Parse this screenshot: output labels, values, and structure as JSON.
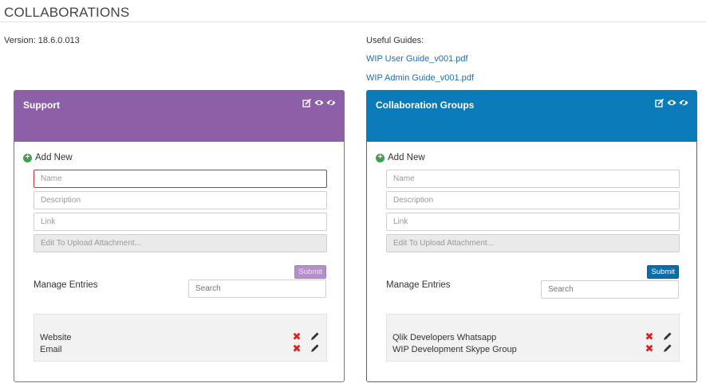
{
  "page": {
    "title": "COLLABORATIONS",
    "version": "Version: 18.6.0.013"
  },
  "guides": {
    "label": "Useful Guides:",
    "links": [
      "WIP User Guide_v001.pdf",
      "WIP Admin Guide_v001.pdf"
    ]
  },
  "panels": [
    {
      "title": "Support",
      "add_new": "Add New",
      "fields": {
        "name": "Name",
        "description": "Description",
        "link": "Link",
        "upload": "Edit To Upload Attachment..."
      },
      "submit": "Submit",
      "manage": "Manage Entries",
      "search_placeholder": "Search",
      "entries": [
        "Website",
        "Email"
      ],
      "accent": "#8c5fa7"
    },
    {
      "title": "Collaboration Groups",
      "add_new": "Add New",
      "fields": {
        "name": "Name",
        "description": "Description",
        "link": "Link",
        "upload": "Edit To Upload Attachment..."
      },
      "submit": "Submit",
      "manage": "Manage Entries",
      "search_placeholder": "Search",
      "entries": [
        "Qlik Developers Whatsapp",
        "WIP Development Skype Group"
      ],
      "accent": "#0b7ab8"
    }
  ],
  "icons": {
    "header": [
      "edit-icon",
      "eye-icon",
      "eye-slash-icon"
    ],
    "row": [
      "delete-x-icon",
      "pencil-icon"
    ]
  }
}
